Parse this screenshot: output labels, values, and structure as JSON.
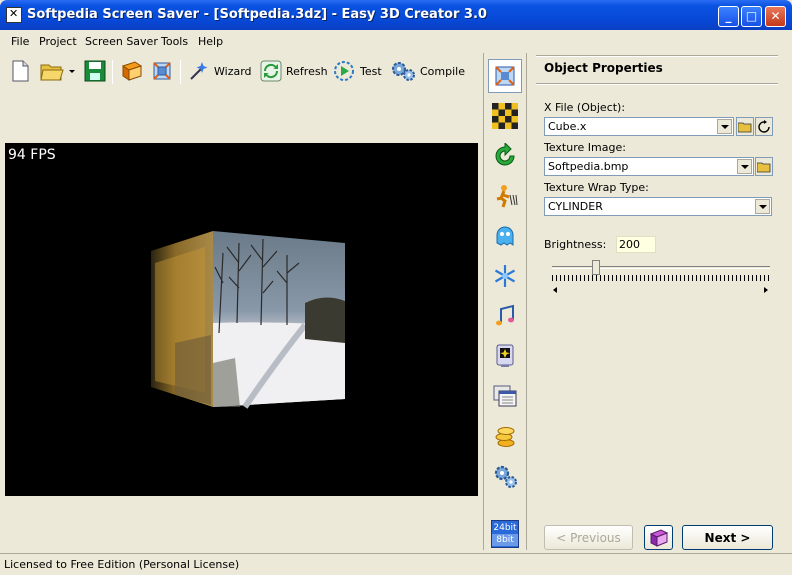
{
  "window": {
    "title": "Softpedia Screen Saver - [Softpedia.3dz] - Easy 3D Creator 3.0",
    "minimize_glyph": "_",
    "maximize_glyph": "□",
    "close_glyph": "✕"
  },
  "menu": [
    "File",
    "Project",
    "Screen Saver",
    "Tools",
    "Help"
  ],
  "toolbar": {
    "wizard_label": "Wizard",
    "refresh_label": "Refresh",
    "test_label": "Test",
    "compile_label": "Compile"
  },
  "viewport": {
    "fps_text": "94 FPS"
  },
  "strip": {
    "bit_top": "24bit",
    "bit_bottom": "8bit"
  },
  "panel": {
    "title": "Object Properties",
    "xfile_label": "X File (Object):",
    "xfile_value": "Cube.x",
    "texture_label": "Texture Image:",
    "texture_value": "Softpedia.bmp",
    "wrap_label": "Texture Wrap Type:",
    "wrap_value": "CYLINDER",
    "brightness_label": "Brightness:",
    "brightness_value": "200",
    "previous_label": "< Previous",
    "next_label": "Next >"
  },
  "status": {
    "text": "Licensed to Free Edition (Personal License)"
  },
  "colors": {
    "titlebar": "#0a52e0",
    "face": "#ece9d8",
    "viewport": "#000000"
  }
}
